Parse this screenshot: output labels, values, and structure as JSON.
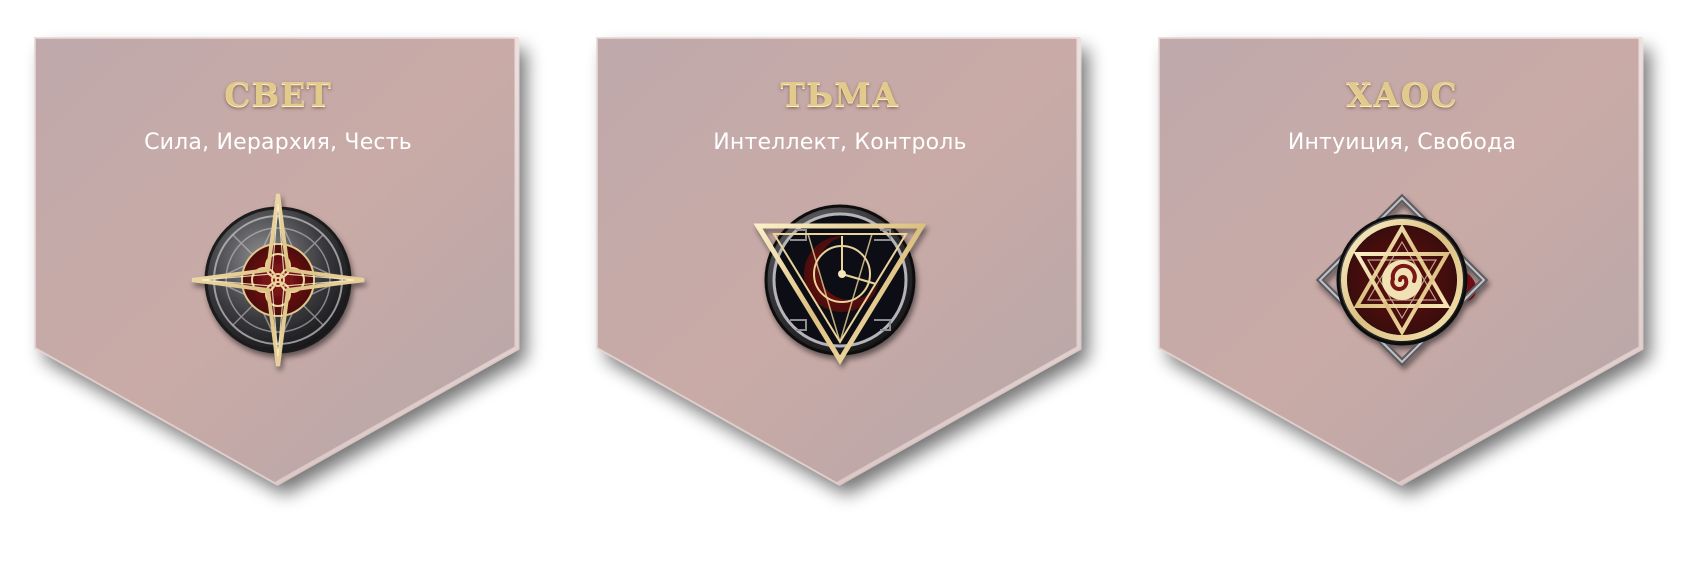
{
  "cards": [
    {
      "title": "СВЕТ",
      "subtitle": "Сила, Иерархия, Честь",
      "icon": "compass-star-emblem-icon"
    },
    {
      "title": "ТЬМА",
      "subtitle": "Интеллект, Контроль",
      "icon": "triangle-crescent-emblem-icon"
    },
    {
      "title": "ХАОС",
      "subtitle": "Интуиция, Свобода",
      "icon": "hexagram-spiral-emblem-icon"
    }
  ],
  "colors": {
    "card_fill_light": "#c9aaa6",
    "card_fill_dark": "#b7a6a8",
    "title_gold": "#e2c98c",
    "subtitle": "#ffffff",
    "emblem_gold": "#e9d39a",
    "emblem_red": "#6e0f12"
  }
}
